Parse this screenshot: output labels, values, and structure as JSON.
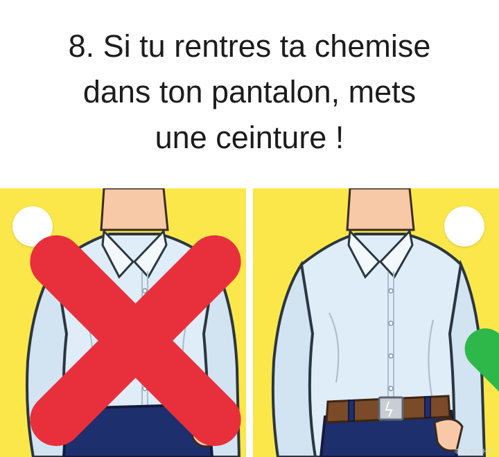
{
  "title": {
    "lines": [
      "8. Si tu rentres ta chemise",
      "dans ton pantalon, mets",
      "une ceinture !"
    ]
  },
  "panels": [
    {
      "id": "without-belt",
      "status_icon": "cross-icon",
      "status_color": "#e8303c"
    },
    {
      "id": "with-belt",
      "status_icon": "check-icon",
      "status_color": "#2fb84a"
    }
  ],
  "colors": {
    "background": "#fbe74a",
    "skin": "#f7c9a6",
    "shirt": "#dfedf8",
    "pants": "#1e2f6e",
    "belt": "#7b4a28",
    "buckle": "#c7ced6"
  },
  "watermark": "© BRIGHT"
}
